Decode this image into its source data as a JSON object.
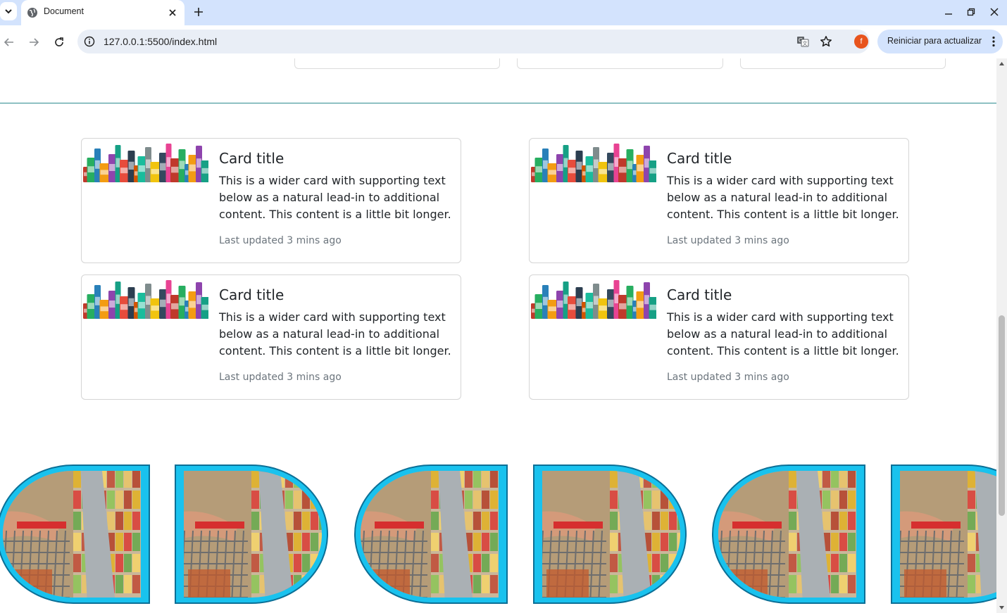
{
  "browser": {
    "tab_title": "Document",
    "url": "127.0.0.1:5500/index.html",
    "profile_initial": "f",
    "update_label": "Reiniciar para actualizar",
    "accent": "#d3e3fd"
  },
  "cards": [
    {
      "title": "Card title",
      "text": "This is a wider card with supporting text below as a natural lead-in to additional content. This content is a little bit longer.",
      "updated": "Last updated 3 mins ago"
    },
    {
      "title": "Card title",
      "text": "This is a wider card with supporting text below as a natural lead-in to additional content. This content is a little bit longer.",
      "updated": "Last updated 3 mins ago"
    },
    {
      "title": "Card title",
      "text": "This is a wider card with supporting text below as a natural lead-in to additional content. This content is a little bit longer.",
      "updated": "Last updated 3 mins ago"
    },
    {
      "title": "Card title",
      "text": "This is a wider card with supporting text below as a natural lead-in to additional content. This content is a little bit longer.",
      "updated": "Last updated 3 mins ago"
    }
  ],
  "colors": {
    "divider": "#2b8a8f",
    "photo_border": "#19c2ee"
  }
}
